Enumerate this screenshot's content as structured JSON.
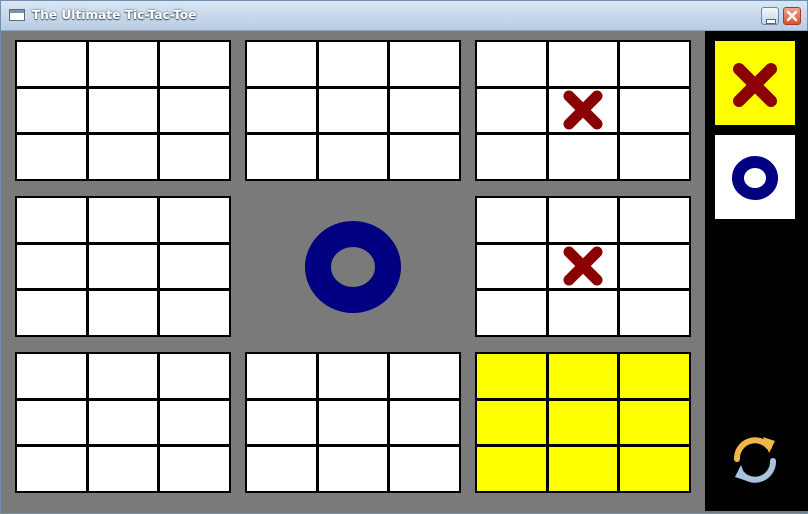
{
  "window": {
    "title": "The Ultimate Tic-Tac-Toe"
  },
  "icons": {
    "app": "window-icon",
    "minimize": "minimize-icon",
    "close": "close-icon",
    "reset": "refresh-icon"
  },
  "colors": {
    "x_mark": "#8b0000",
    "o_mark": "#000080",
    "active_highlight": "#ffff00",
    "board_background": "#7a7a7a",
    "sidebar_background": "#000000"
  },
  "board": {
    "boards": [
      {
        "position": "top-left",
        "winner": "",
        "highlight": false,
        "cells": [
          "",
          "",
          "",
          "",
          "",
          "",
          "",
          "",
          ""
        ]
      },
      {
        "position": "top-middle",
        "winner": "",
        "highlight": false,
        "cells": [
          "",
          "",
          "",
          "",
          "",
          "",
          "",
          "",
          ""
        ]
      },
      {
        "position": "top-right",
        "winner": "",
        "highlight": false,
        "cells": [
          "",
          "",
          "",
          "",
          "X",
          "",
          "",
          "",
          ""
        ]
      },
      {
        "position": "middle-left",
        "winner": "",
        "highlight": false,
        "cells": [
          "",
          "",
          "",
          "",
          "",
          "",
          "",
          "",
          ""
        ]
      },
      {
        "position": "center",
        "winner": "O",
        "highlight": false,
        "cells": []
      },
      {
        "position": "middle-right",
        "winner": "",
        "highlight": false,
        "cells": [
          "",
          "",
          "",
          "",
          "X",
          "",
          "",
          "",
          ""
        ]
      },
      {
        "position": "bottom-left",
        "winner": "",
        "highlight": false,
        "cells": [
          "",
          "",
          "",
          "",
          "",
          "",
          "",
          "",
          ""
        ]
      },
      {
        "position": "bottom-middle",
        "winner": "",
        "highlight": false,
        "cells": [
          "",
          "",
          "",
          "",
          "",
          "",
          "",
          "",
          ""
        ]
      },
      {
        "position": "bottom-right",
        "winner": "",
        "highlight": true,
        "cells": [
          "",
          "",
          "",
          "",
          "",
          "",
          "",
          "",
          ""
        ]
      }
    ]
  },
  "sidebar": {
    "players": [
      {
        "mark": "X",
        "active": true
      },
      {
        "mark": "O",
        "active": false
      }
    ]
  }
}
